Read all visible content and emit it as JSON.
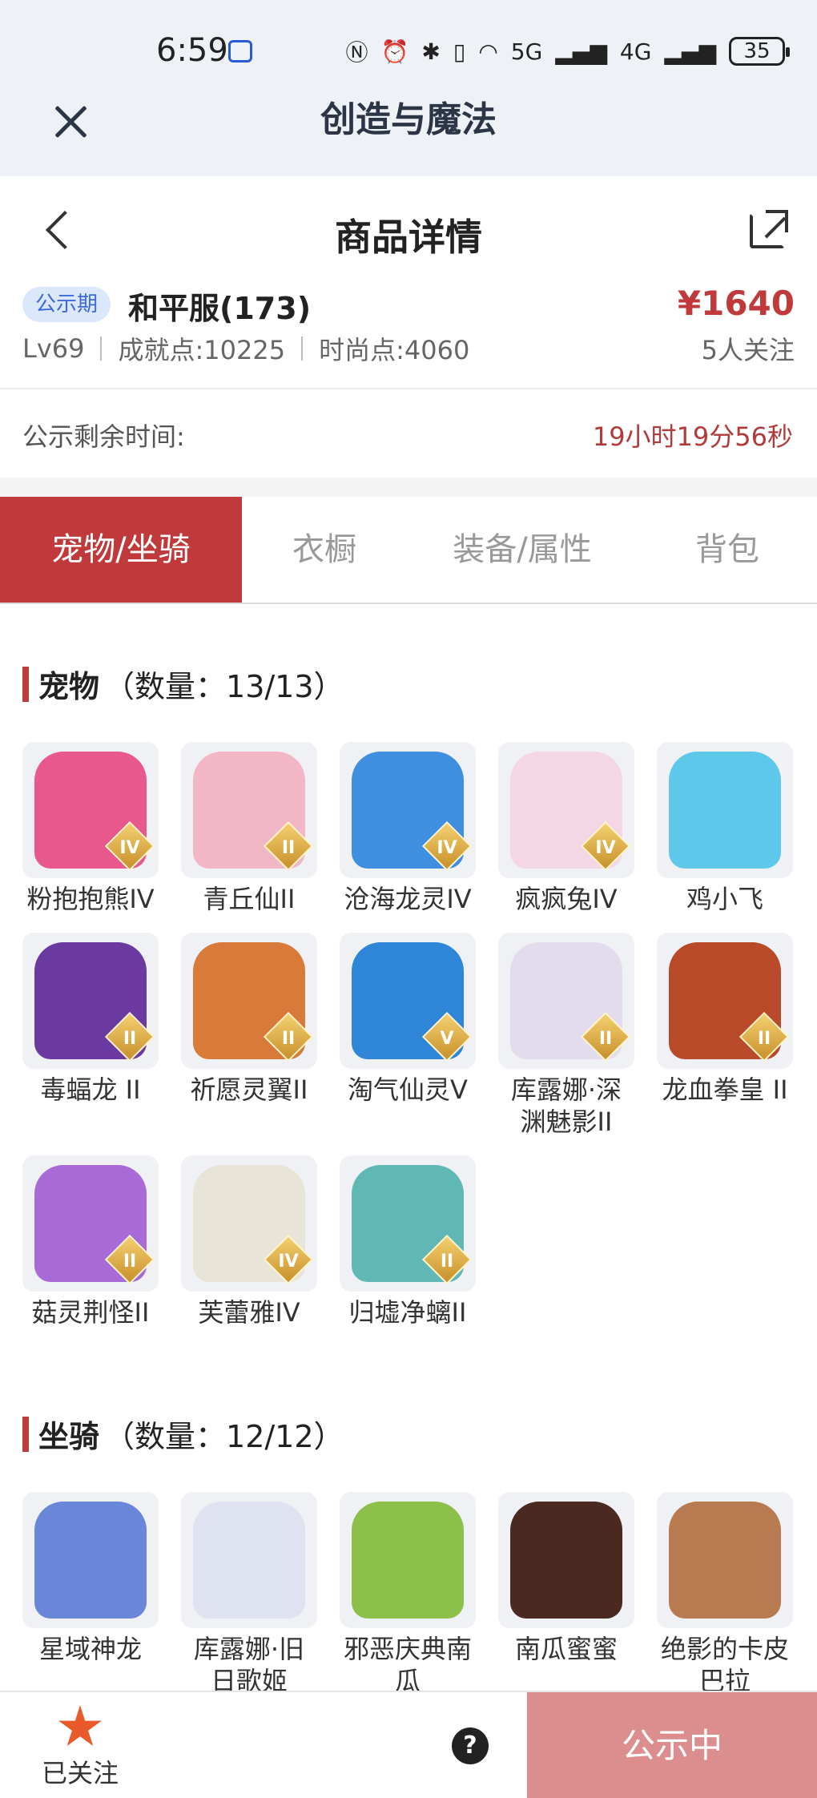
{
  "status_bar": {
    "time": "6:59",
    "network1": "5G",
    "network2": "4G",
    "battery": "35"
  },
  "app": {
    "title": "创造与魔法"
  },
  "nav": {
    "title": "商品详情"
  },
  "item": {
    "badge": "公示期",
    "server": "和平服(173)",
    "price": "¥1640",
    "level": "Lv69",
    "achievement": "成就点:10225",
    "fashion": "时尚点:4060",
    "followers": "5人关注"
  },
  "countdown": {
    "label": "公示剩余时间:",
    "value": "19小时19分56秒"
  },
  "tabs": [
    {
      "label": "宠物/坐骑"
    },
    {
      "label": "衣橱"
    },
    {
      "label": "装备/属性"
    },
    {
      "label": "背包"
    }
  ],
  "pets": {
    "title": "宠物",
    "count": "（数量：13/13）",
    "items": [
      {
        "name": "粉抱抱熊IV",
        "rank": "IV",
        "color": "#e8588c"
      },
      {
        "name": "青丘仙II",
        "rank": "II",
        "color": "#f2b6c6"
      },
      {
        "name": "沧海龙灵IV",
        "rank": "IV",
        "color": "#3f8fe0"
      },
      {
        "name": "疯疯兔IV",
        "rank": "IV",
        "color": "#f4d6e4"
      },
      {
        "name": "鸡小飞",
        "rank": "",
        "color": "#5ec8ea"
      },
      {
        "name": "毒蝠龙 II",
        "rank": "II",
        "color": "#6a3aa0"
      },
      {
        "name": "祈愿灵翼II",
        "rank": "II",
        "color": "#d77a3a"
      },
      {
        "name": "淘气仙灵V",
        "rank": "V",
        "color": "#2f86d8"
      },
      {
        "name": "库露娜·深渊魅影II",
        "rank": "II",
        "color": "#e3dcec"
      },
      {
        "name": "龙血拳皇 II",
        "rank": "II",
        "color": "#b84a2a"
      },
      {
        "name": "菇灵荆怪II",
        "rank": "II",
        "color": "#a86ad6"
      },
      {
        "name": "芙蕾雅IV",
        "rank": "IV",
        "color": "#e9e4d8"
      },
      {
        "name": "归墟净螭II",
        "rank": "II",
        "color": "#5fb8b4"
      }
    ]
  },
  "mounts": {
    "title": "坐骑",
    "count": "（数量：12/12）",
    "items": [
      {
        "name": "星域神龙",
        "rank": "",
        "color": "#6a86d8"
      },
      {
        "name": "库露娜·旧日歌姬",
        "rank": "",
        "color": "#dfe2f0"
      },
      {
        "name": "邪恶庆典南瓜",
        "rank": "",
        "color": "#8cc04a"
      },
      {
        "name": "南瓜蜜蜜",
        "rank": "",
        "color": "#4a2a20"
      },
      {
        "name": "绝影的卡皮巴拉",
        "rank": "",
        "color": "#b87a50"
      }
    ]
  },
  "bottom": {
    "follow_label": "已关注",
    "help": "?",
    "status_label": "公示中"
  }
}
